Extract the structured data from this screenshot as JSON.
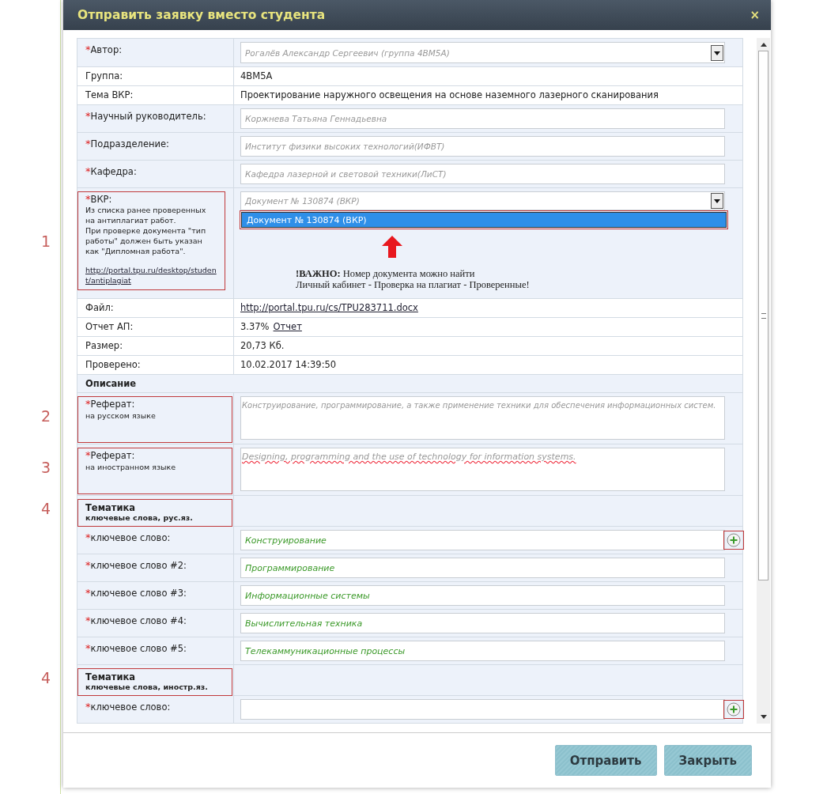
{
  "dialog": {
    "title": "Отправить заявку вместо студента",
    "close": "×"
  },
  "required_mark": "*",
  "rows": [
    {
      "kind": "select",
      "label": "Автор:",
      "required": true,
      "placeholder": "Рогалёв Александр Сергеевич (группа 4ВМ5А)"
    },
    {
      "kind": "text",
      "label": "Группа:",
      "required": false,
      "value": "4ВМ5А"
    },
    {
      "kind": "text",
      "label": "Тема ВКР:",
      "required": false,
      "value": "Проектирование наружного освещения на основе наземного лазерного сканирования"
    },
    {
      "kind": "input",
      "label": "Научный руководитель:",
      "required": true,
      "placeholder": "Коржнева Татьяна Геннадьевна"
    },
    {
      "kind": "input",
      "label": "Подразделение:",
      "required": true,
      "placeholder": "Институт физики высоких технологий(ИФВТ)"
    },
    {
      "kind": "input",
      "label": "Кафедра:",
      "required": true,
      "placeholder": "Кафедра лазерной и световой техники(ЛиСТ)"
    },
    {
      "kind": "document",
      "label": "ВКР:",
      "required": true,
      "highlighted": true,
      "annotation": "1",
      "notes": [
        "Из списка ранее проверенных на антиплагиат работ.",
        "При проверке документа \"тип работы\" должен быть указан как \"Дипломная работа\"."
      ],
      "link": "http://portal.tpu.ru/desktop/student/antiplagiat",
      "placeholder": "Документ № 130874 (ВКР)",
      "options": [
        {
          "label": "Документ № 130874 (ВКР)",
          "selected": true
        }
      ],
      "options_highlighted": true,
      "notice": "**!ВАЖНО:** Номер документа можно найти\nЛичный кабинет - Проверка на плагиат - Проверенные!"
    },
    {
      "kind": "link",
      "label": "Файл:",
      "required": false,
      "link": "http://portal.tpu.ru/cs/TPU283711.docx"
    },
    {
      "kind": "report",
      "label": "Отчет АП:",
      "required": false,
      "value": "3.37%",
      "link": "Отчет"
    },
    {
      "kind": "text",
      "label": "Размер:",
      "required": false,
      "value": "20,73 Кб."
    },
    {
      "kind": "text",
      "label": "Проверено:",
      "required": false,
      "value": "10.02.2017 14:39:50"
    },
    {
      "kind": "section",
      "label": "Описание"
    },
    {
      "kind": "textarea",
      "label": "Реферат:",
      "required": true,
      "sublabel": "на русском языке",
      "highlighted": true,
      "annotation": "2",
      "placeholder": "Конструирование, программирование, а также применение техники  для обеспечения информационных систем."
    },
    {
      "kind": "textarea",
      "label": "Реферат:",
      "required": true,
      "sublabel": "на иностранном языке",
      "highlighted": true,
      "annotation": "3",
      "value": "Designing, programming and the use of technology for information systems."
    },
    {
      "kind": "heading",
      "label": "Тематика",
      "sublabel": "ключевые слова, рус.яз.",
      "highlighted": true,
      "annotation": "4"
    },
    {
      "kind": "input",
      "label": "ключевое слово:",
      "required": true,
      "value": "Конструирование",
      "add_button": true,
      "add_highlighted": true
    },
    {
      "kind": "input",
      "label": "ключевое слово #2:",
      "required": true,
      "value": "Программирование",
      "add_button": false
    },
    {
      "kind": "input",
      "label": "ключевое слово #3:",
      "required": true,
      "value": "Информационные системы",
      "add_button": false
    },
    {
      "kind": "input",
      "label": "ключевое слово #4:",
      "required": true,
      "value": "Вычислительная техника",
      "add_button": false
    },
    {
      "kind": "input",
      "label": "ключевое слово #5:",
      "required": true,
      "value": "Телекаммуникационные процессы",
      "add_button": false
    },
    {
      "kind": "heading",
      "label": "Тематика",
      "sublabel": "ключевые слова, иностр.яз.",
      "highlighted": true,
      "annotation": "4"
    },
    {
      "kind": "input",
      "label": "ключевое слово:",
      "required": true,
      "add_button": true,
      "add_highlighted": true
    }
  ],
  "buttons": [
    {
      "label": "Отправить"
    },
    {
      "label": "Закрыть"
    }
  ]
}
